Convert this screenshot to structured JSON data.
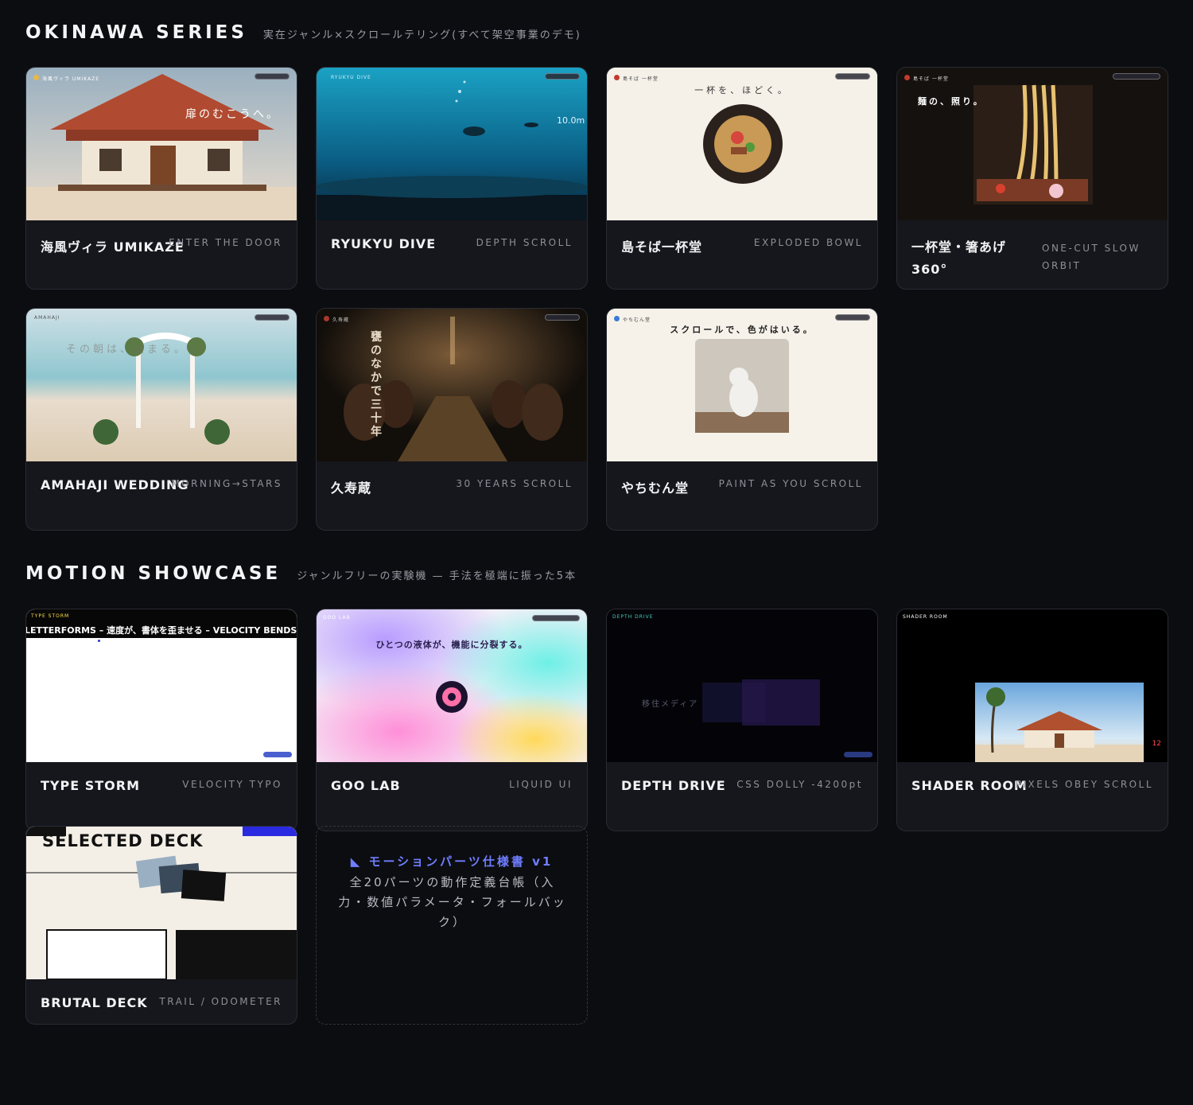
{
  "sections": [
    {
      "title": "OKINAWA SERIES",
      "subtitle": "実在ジャンル×スクロールテリング(すべて架空事業のデモ)"
    },
    {
      "title": "MOTION SHOWCASE",
      "subtitle": "ジャンルフリーの実験機 — 手法を極端に振った5本"
    }
  ],
  "okinawa": [
    {
      "title": "海風ヴィラ UMIKAZE",
      "tag": "ENTER THE DOOR",
      "thumb_text": "扉のむこうへ。",
      "thumb_brand": "海風ヴィラ UMIKAZE"
    },
    {
      "title": "RYUKYU DIVE",
      "tag": "DEPTH SCROLL",
      "thumb_text": "10.0m",
      "thumb_brand": "RYUKYU DIVE"
    },
    {
      "title": "島そば一杯堂",
      "tag": "EXPLODED BOWL",
      "thumb_text": "一杯を、ほどく。",
      "thumb_brand": "島そば 一杯堂"
    },
    {
      "title": "一杯堂・箸あげ 360°",
      "tag": "ONE-CUT SLOW ORBIT",
      "thumb_text": "麺の、照り。",
      "thumb_brand": "島そば 一杯堂"
    },
    {
      "title": "AMAHAJI WEDDING",
      "tag": "MORNING→STARS",
      "thumb_text": "その朝は、始まる。",
      "thumb_brand": "AMAHAJI"
    },
    {
      "title": "久寿蔵",
      "tag": "30 YEARS SCROLL",
      "thumb_text": "甕のなかで三十年",
      "thumb_brand": "久寿蔵"
    },
    {
      "title": "やちむん堂",
      "tag": "PAINT AS YOU SCROLL",
      "thumb_text": "スクロールで、色がはいる。",
      "thumb_brand": "やちむん堂"
    }
  ],
  "motion": [
    {
      "title": "TYPE STORM",
      "tag": "VELOCITY TYPO",
      "thumb_text": "LETTERFORMS – 速度が、書体を歪ませる – VELOCITY BENDS LETTERS",
      "thumb_brand": "TYPE STORM"
    },
    {
      "title": "GOO LAB",
      "tag": "LIQUID UI",
      "thumb_text": "ひとつの液体が、機能に分裂する。",
      "thumb_brand": "GOO LAB"
    },
    {
      "title": "DEPTH DRIVE",
      "tag": "CSS DOLLY -4200pt",
      "thumb_text": "移住メディア",
      "thumb_brand": "DEPTH DRIVE"
    },
    {
      "title": "SHADER ROOM",
      "tag": "PIXELS OBEY SCROLL",
      "thumb_text": "12",
      "thumb_brand": "SHADER ROOM"
    },
    {
      "title": "BRUTAL DECK",
      "tag": "TRAIL / ODOMETER",
      "thumb_text": "SELECTED DECK",
      "thumb_brand": "BRUTAL DECK"
    }
  ],
  "spec": {
    "title": "◣ モーションパーツ仕様書 v1",
    "desc": "全20パーツの動作定義台帳（入力・数値パラメータ・フォールバック）"
  },
  "colors": {
    "background": "#0c0d11",
    "card": "#16171c",
    "accent": "#6f7dff"
  }
}
